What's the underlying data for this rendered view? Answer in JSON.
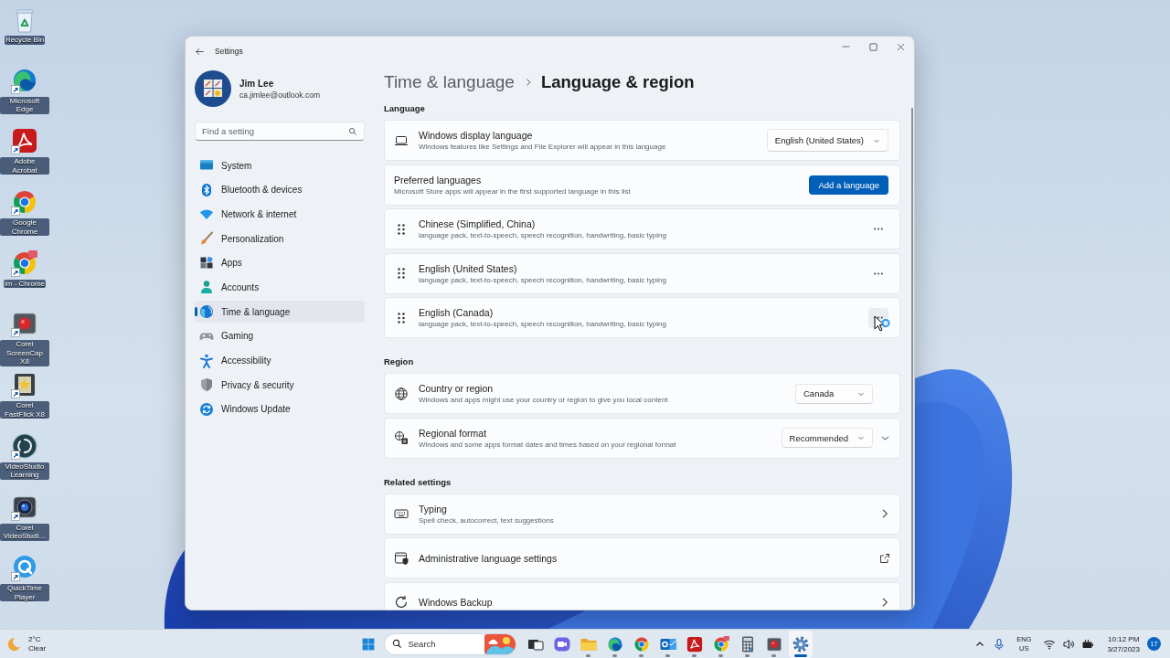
{
  "desktop": {
    "icons": [
      {
        "label": "Recycle Bin"
      },
      {
        "label": "Microsoft Edge"
      },
      {
        "label": "Adobe Acrobat"
      },
      {
        "label": "Google Chrome"
      },
      {
        "label": "im - Chrome"
      },
      {
        "label": "Corel ScreenCap X8"
      },
      {
        "label": "Corel FastFlick X8"
      },
      {
        "label": "VideoStudio Learning"
      },
      {
        "label": "Corel VideoStudi…"
      },
      {
        "label": "QuickTime Player"
      }
    ]
  },
  "window": {
    "title": "Settings",
    "account": {
      "name": "Jim Lee",
      "email": "ca.jimlee@outlook.com"
    },
    "search": {
      "placeholder": "Find a setting"
    },
    "nav": [
      {
        "label": "System",
        "selected": false
      },
      {
        "label": "Bluetooth & devices",
        "selected": false
      },
      {
        "label": "Network & internet",
        "selected": false
      },
      {
        "label": "Personalization",
        "selected": false
      },
      {
        "label": "Apps",
        "selected": false
      },
      {
        "label": "Accounts",
        "selected": false
      },
      {
        "label": "Time & language",
        "selected": true
      },
      {
        "label": "Gaming",
        "selected": false
      },
      {
        "label": "Accessibility",
        "selected": false
      },
      {
        "label": "Privacy & security",
        "selected": false
      },
      {
        "label": "Windows Update",
        "selected": false
      }
    ],
    "breadcrumb": {
      "parent": "Time & language",
      "current": "Language & region"
    },
    "language": {
      "heading": "Language",
      "display_language": {
        "title": "Windows display language",
        "description": "Windows features like Settings and File Explorer will appear in this language",
        "value": "English (United States)"
      },
      "preferred": {
        "title": "Preferred languages",
        "description": "Microsoft Store apps will appear in the first supported language in this list",
        "button": "Add a language"
      },
      "languages": [
        {
          "name": "Chinese (Simplified, China)",
          "features": "language pack, text-to-speech, speech recognition, handwriting, basic typing",
          "hovered": false
        },
        {
          "name": "English (United States)",
          "features": "language pack, text-to-speech, speech recognition, handwriting, basic typing",
          "hovered": false
        },
        {
          "name": "English (Canada)",
          "features": "language pack, text-to-speech, speech recognition, handwriting, basic typing",
          "hovered": true
        }
      ]
    },
    "region": {
      "heading": "Region",
      "rows": [
        {
          "kind": "select",
          "title": "Country or region",
          "description": "Windows and apps might use your country or region to give you local content",
          "value": "Canada"
        },
        {
          "kind": "expandable-select",
          "title": "Regional format",
          "description": "Windows and some apps format dates and times based on your regional format",
          "value": "Recommended",
          "expanded": false
        }
      ]
    },
    "related": {
      "heading": "Related settings",
      "items": [
        {
          "kind": "link",
          "title": "Typing",
          "description": "Spell check, autocorrect, text suggestions"
        },
        {
          "kind": "external",
          "title": "Administrative language settings"
        },
        {
          "kind": "link",
          "title": "Windows Backup"
        }
      ]
    }
  },
  "taskbar": {
    "weather": {
      "temperature": "2°C",
      "condition": "Clear"
    },
    "search": {
      "placeholder": "Search"
    },
    "apps": [
      {
        "running": false,
        "selected": false
      },
      {
        "running": false,
        "selected": false
      },
      {
        "running": true,
        "selected": false
      },
      {
        "running": true,
        "selected": false
      },
      {
        "running": true,
        "selected": false
      },
      {
        "running": true,
        "selected": false
      },
      {
        "running": true,
        "selected": false
      },
      {
        "running": true,
        "selected": false
      },
      {
        "running": true,
        "selected": false
      },
      {
        "running": true,
        "selected": false
      },
      {
        "running": true,
        "selected": true
      }
    ],
    "tray": {
      "language": "ENG",
      "layout": "US",
      "time": "10:12 PM",
      "date": "3/27/2023",
      "notifications": "17"
    }
  }
}
